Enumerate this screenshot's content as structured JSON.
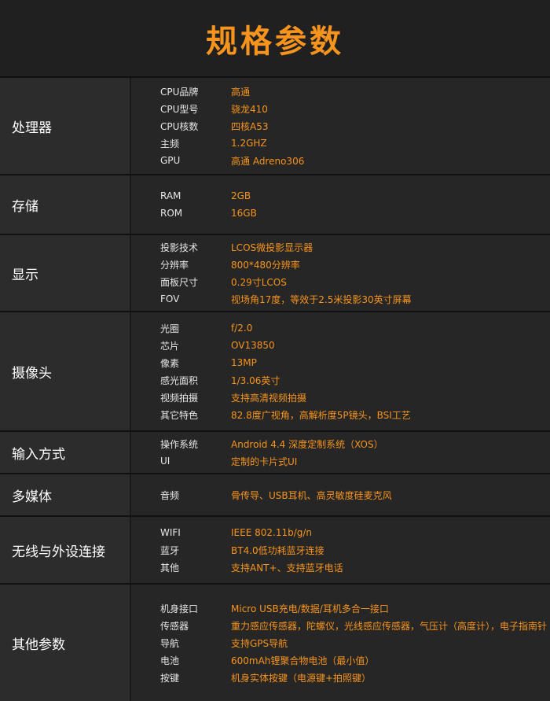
{
  "title": "规格参数",
  "sections": [
    {
      "category": "处理器",
      "items": [
        {
          "label": "CPU品牌",
          "value": "高通"
        },
        {
          "label": "CPU型号",
          "value": "骁龙410"
        },
        {
          "label": "CPU核数",
          "value": "四核A53"
        },
        {
          "label": "主频",
          "value": "1.2GHZ"
        },
        {
          "label": "GPU",
          "value": "高通 Adreno306"
        }
      ]
    },
    {
      "category": "存储",
      "items": [
        {
          "label": "RAM",
          "value": "2GB"
        },
        {
          "label": "ROM",
          "value": "16GB"
        }
      ]
    },
    {
      "category": "显示",
      "items": [
        {
          "label": "投影技术",
          "value": "LCOS微投影显示器"
        },
        {
          "label": "分辨率",
          "value": "800*480分辨率"
        },
        {
          "label": "面板尺寸",
          "value": "0.29寸LCOS"
        },
        {
          "label": "FOV",
          "value": "视场角17度，等效于2.5米投影30英寸屏幕"
        }
      ]
    },
    {
      "category": "摄像头",
      "items": [
        {
          "label": "光圈",
          "value": "f/2.0"
        },
        {
          "label": "芯片",
          "value": "OV13850"
        },
        {
          "label": "像素",
          "value": "13MP"
        },
        {
          "label": "感光面积",
          "value": "1/3.06英寸"
        },
        {
          "label": "视频拍摄",
          "value": "支持高清视频拍摄"
        },
        {
          "label": "其它特色",
          "value": "82.8度广视角，高解析度5P镜头，BSI工艺"
        }
      ]
    },
    {
      "category": "输入方式",
      "items": [
        {
          "label": "操作系统",
          "value": "Android 4.4 深度定制系统（XOS）"
        },
        {
          "label": "UI",
          "value": "定制的卡片式UI"
        }
      ]
    },
    {
      "category": "多媒体",
      "items": [
        {
          "label": "音频",
          "value": "骨传导、USB耳机、高灵敏度硅麦克风"
        }
      ]
    },
    {
      "category": "无线与外设连接",
      "items": [
        {
          "label": "WIFI",
          "value": "IEEE 802.11b/g/n"
        },
        {
          "label": "蓝牙",
          "value": "BT4.0低功耗蓝牙连接"
        },
        {
          "label": "其他",
          "value": "支持ANT+、支持蓝牙电话"
        }
      ]
    },
    {
      "category": "其他参数",
      "items": [
        {
          "label": "机身接口",
          "value": "Micro USB充电/数据/耳机多合一接口"
        },
        {
          "label": "传感器",
          "value": "重力感应传感器，陀螺仪，光线感应传感器，气压计（高度计），电子指南针"
        },
        {
          "label": "导航",
          "value": "支持GPS导航"
        },
        {
          "label": "电池",
          "value": "600mAh锂聚合物电池（最小值）"
        },
        {
          "label": "按键",
          "value": "机身实体按键（电源键+拍照键）"
        }
      ]
    }
  ]
}
